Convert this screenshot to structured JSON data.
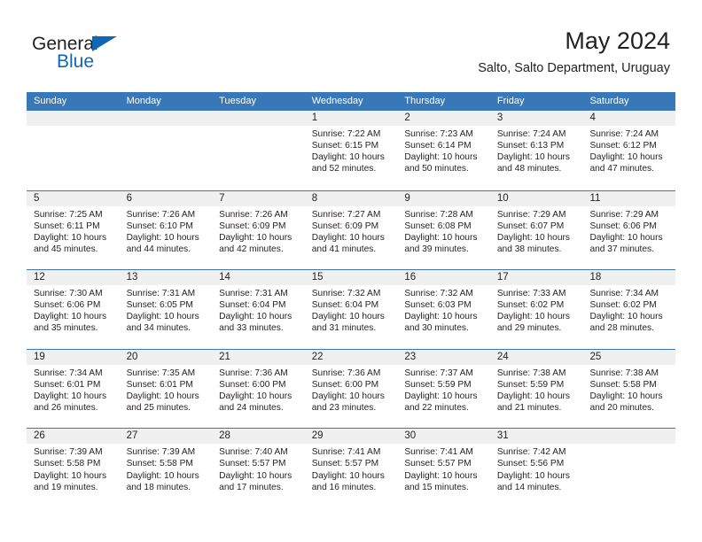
{
  "brand": {
    "name_part1": "General",
    "name_part2": "Blue",
    "triangle_color": "#1267b2",
    "accent_color": "#3878b9"
  },
  "header": {
    "title": "May 2024",
    "subtitle": "Salto, Salto Department, Uruguay"
  },
  "calendar": {
    "day_names": [
      "Sunday",
      "Monday",
      "Tuesday",
      "Wednesday",
      "Thursday",
      "Friday",
      "Saturday"
    ],
    "labels": {
      "sunrise": "Sunrise:",
      "sunset": "Sunset:",
      "daylight": "Daylight:"
    },
    "weeks": [
      [
        {
          "day": "",
          "empty": true
        },
        {
          "day": "",
          "empty": true
        },
        {
          "day": "",
          "empty": true
        },
        {
          "day": "1",
          "sunrise": "Sunrise: 7:22 AM",
          "sunset": "Sunset: 6:15 PM",
          "daylight_line1": "Daylight: 10 hours",
          "daylight_line2": "and 52 minutes."
        },
        {
          "day": "2",
          "sunrise": "Sunrise: 7:23 AM",
          "sunset": "Sunset: 6:14 PM",
          "daylight_line1": "Daylight: 10 hours",
          "daylight_line2": "and 50 minutes."
        },
        {
          "day": "3",
          "sunrise": "Sunrise: 7:24 AM",
          "sunset": "Sunset: 6:13 PM",
          "daylight_line1": "Daylight: 10 hours",
          "daylight_line2": "and 48 minutes."
        },
        {
          "day": "4",
          "sunrise": "Sunrise: 7:24 AM",
          "sunset": "Sunset: 6:12 PM",
          "daylight_line1": "Daylight: 10 hours",
          "daylight_line2": "and 47 minutes."
        }
      ],
      [
        {
          "day": "5",
          "sunrise": "Sunrise: 7:25 AM",
          "sunset": "Sunset: 6:11 PM",
          "daylight_line1": "Daylight: 10 hours",
          "daylight_line2": "and 45 minutes."
        },
        {
          "day": "6",
          "sunrise": "Sunrise: 7:26 AM",
          "sunset": "Sunset: 6:10 PM",
          "daylight_line1": "Daylight: 10 hours",
          "daylight_line2": "and 44 minutes."
        },
        {
          "day": "7",
          "sunrise": "Sunrise: 7:26 AM",
          "sunset": "Sunset: 6:09 PM",
          "daylight_line1": "Daylight: 10 hours",
          "daylight_line2": "and 42 minutes."
        },
        {
          "day": "8",
          "sunrise": "Sunrise: 7:27 AM",
          "sunset": "Sunset: 6:09 PM",
          "daylight_line1": "Daylight: 10 hours",
          "daylight_line2": "and 41 minutes."
        },
        {
          "day": "9",
          "sunrise": "Sunrise: 7:28 AM",
          "sunset": "Sunset: 6:08 PM",
          "daylight_line1": "Daylight: 10 hours",
          "daylight_line2": "and 39 minutes."
        },
        {
          "day": "10",
          "sunrise": "Sunrise: 7:29 AM",
          "sunset": "Sunset: 6:07 PM",
          "daylight_line1": "Daylight: 10 hours",
          "daylight_line2": "and 38 minutes."
        },
        {
          "day": "11",
          "sunrise": "Sunrise: 7:29 AM",
          "sunset": "Sunset: 6:06 PM",
          "daylight_line1": "Daylight: 10 hours",
          "daylight_line2": "and 37 minutes."
        }
      ],
      [
        {
          "day": "12",
          "sunrise": "Sunrise: 7:30 AM",
          "sunset": "Sunset: 6:06 PM",
          "daylight_line1": "Daylight: 10 hours",
          "daylight_line2": "and 35 minutes."
        },
        {
          "day": "13",
          "sunrise": "Sunrise: 7:31 AM",
          "sunset": "Sunset: 6:05 PM",
          "daylight_line1": "Daylight: 10 hours",
          "daylight_line2": "and 34 minutes."
        },
        {
          "day": "14",
          "sunrise": "Sunrise: 7:31 AM",
          "sunset": "Sunset: 6:04 PM",
          "daylight_line1": "Daylight: 10 hours",
          "daylight_line2": "and 33 minutes."
        },
        {
          "day": "15",
          "sunrise": "Sunrise: 7:32 AM",
          "sunset": "Sunset: 6:04 PM",
          "daylight_line1": "Daylight: 10 hours",
          "daylight_line2": "and 31 minutes."
        },
        {
          "day": "16",
          "sunrise": "Sunrise: 7:32 AM",
          "sunset": "Sunset: 6:03 PM",
          "daylight_line1": "Daylight: 10 hours",
          "daylight_line2": "and 30 minutes."
        },
        {
          "day": "17",
          "sunrise": "Sunrise: 7:33 AM",
          "sunset": "Sunset: 6:02 PM",
          "daylight_line1": "Daylight: 10 hours",
          "daylight_line2": "and 29 minutes."
        },
        {
          "day": "18",
          "sunrise": "Sunrise: 7:34 AM",
          "sunset": "Sunset: 6:02 PM",
          "daylight_line1": "Daylight: 10 hours",
          "daylight_line2": "and 28 minutes."
        }
      ],
      [
        {
          "day": "19",
          "sunrise": "Sunrise: 7:34 AM",
          "sunset": "Sunset: 6:01 PM",
          "daylight_line1": "Daylight: 10 hours",
          "daylight_line2": "and 26 minutes."
        },
        {
          "day": "20",
          "sunrise": "Sunrise: 7:35 AM",
          "sunset": "Sunset: 6:01 PM",
          "daylight_line1": "Daylight: 10 hours",
          "daylight_line2": "and 25 minutes."
        },
        {
          "day": "21",
          "sunrise": "Sunrise: 7:36 AM",
          "sunset": "Sunset: 6:00 PM",
          "daylight_line1": "Daylight: 10 hours",
          "daylight_line2": "and 24 minutes."
        },
        {
          "day": "22",
          "sunrise": "Sunrise: 7:36 AM",
          "sunset": "Sunset: 6:00 PM",
          "daylight_line1": "Daylight: 10 hours",
          "daylight_line2": "and 23 minutes."
        },
        {
          "day": "23",
          "sunrise": "Sunrise: 7:37 AM",
          "sunset": "Sunset: 5:59 PM",
          "daylight_line1": "Daylight: 10 hours",
          "daylight_line2": "and 22 minutes."
        },
        {
          "day": "24",
          "sunrise": "Sunrise: 7:38 AM",
          "sunset": "Sunset: 5:59 PM",
          "daylight_line1": "Daylight: 10 hours",
          "daylight_line2": "and 21 minutes."
        },
        {
          "day": "25",
          "sunrise": "Sunrise: 7:38 AM",
          "sunset": "Sunset: 5:58 PM",
          "daylight_line1": "Daylight: 10 hours",
          "daylight_line2": "and 20 minutes."
        }
      ],
      [
        {
          "day": "26",
          "sunrise": "Sunrise: 7:39 AM",
          "sunset": "Sunset: 5:58 PM",
          "daylight_line1": "Daylight: 10 hours",
          "daylight_line2": "and 19 minutes."
        },
        {
          "day": "27",
          "sunrise": "Sunrise: 7:39 AM",
          "sunset": "Sunset: 5:58 PM",
          "daylight_line1": "Daylight: 10 hours",
          "daylight_line2": "and 18 minutes."
        },
        {
          "day": "28",
          "sunrise": "Sunrise: 7:40 AM",
          "sunset": "Sunset: 5:57 PM",
          "daylight_line1": "Daylight: 10 hours",
          "daylight_line2": "and 17 minutes."
        },
        {
          "day": "29",
          "sunrise": "Sunrise: 7:41 AM",
          "sunset": "Sunset: 5:57 PM",
          "daylight_line1": "Daylight: 10 hours",
          "daylight_line2": "and 16 minutes."
        },
        {
          "day": "30",
          "sunrise": "Sunrise: 7:41 AM",
          "sunset": "Sunset: 5:57 PM",
          "daylight_line1": "Daylight: 10 hours",
          "daylight_line2": "and 15 minutes."
        },
        {
          "day": "31",
          "sunrise": "Sunrise: 7:42 AM",
          "sunset": "Sunset: 5:56 PM",
          "daylight_line1": "Daylight: 10 hours",
          "daylight_line2": "and 14 minutes."
        },
        {
          "day": "",
          "empty": true
        }
      ]
    ]
  }
}
